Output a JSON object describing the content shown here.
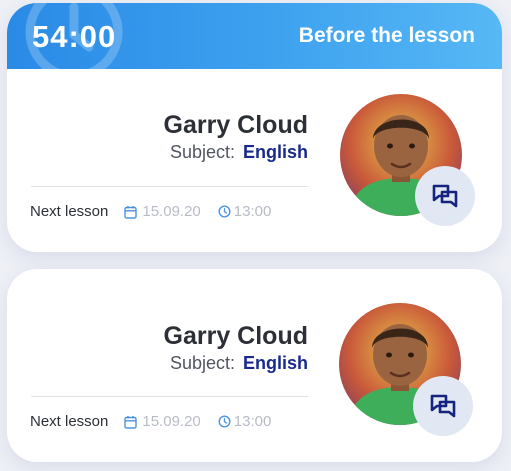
{
  "session": {
    "timer": "54:00",
    "status_label": "Before the lesson"
  },
  "lessons": [
    {
      "teacher_name": "Garry Cloud",
      "subject_label": "Subject:",
      "subject_value": "English",
      "next_lesson_label": "Next lesson",
      "date": "15.09.20",
      "time": "13:00"
    },
    {
      "teacher_name": "Garry Cloud",
      "subject_label": "Subject:",
      "subject_value": "English",
      "next_lesson_label": "Next lesson",
      "date": "15.09.20",
      "time": "13:00"
    }
  ],
  "icons": {
    "date": "calendar-icon",
    "time": "clock-icon",
    "chat": "chat-icon"
  },
  "colors": {
    "banner_gradient_start": "#2a8ae6",
    "banner_gradient_end": "#57b8f5",
    "subject_accent": "#1a2a8c",
    "muted_text": "#b7bcc6"
  }
}
